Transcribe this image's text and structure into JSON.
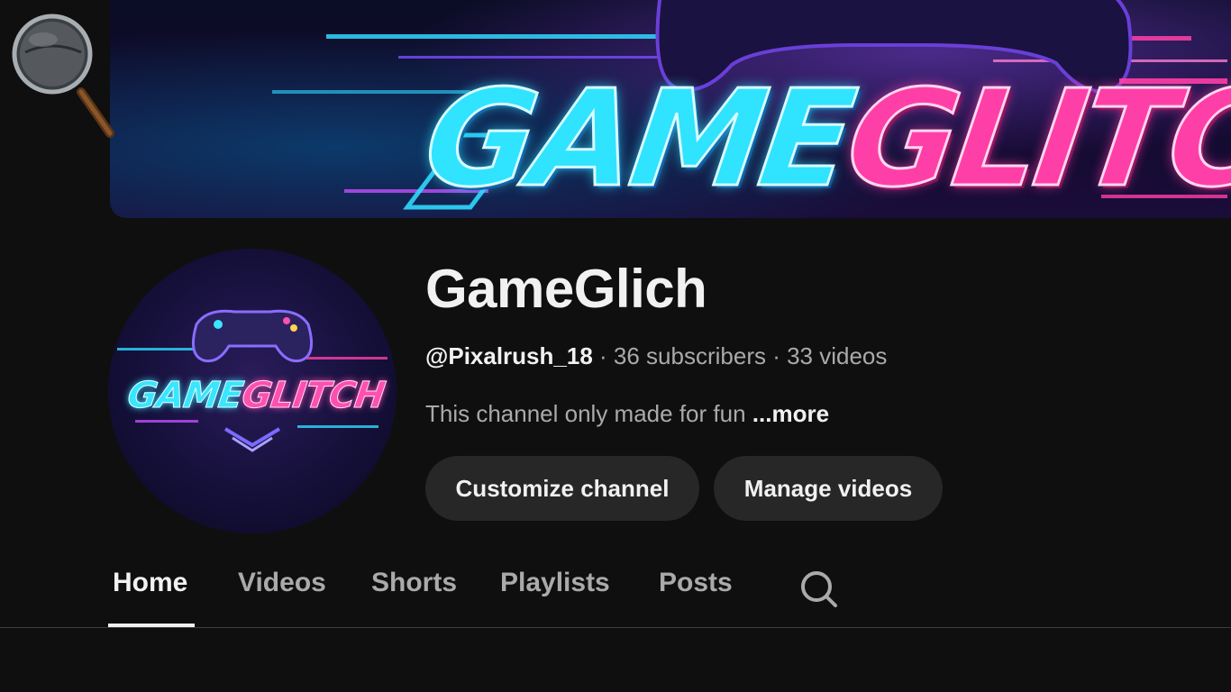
{
  "banner": {
    "text_part_a": "GAME",
    "text_part_b": "GLITC"
  },
  "avatar": {
    "text_part_a": "GAME",
    "text_part_b": "GLITCH"
  },
  "channel": {
    "name": "GameGlich",
    "handle": "@Pixalrush_18",
    "separator": " · ",
    "subscribers": "36 subscribers",
    "videos": "33 videos",
    "description": "This channel only made for fun",
    "more_label": "...more"
  },
  "buttons": {
    "customize": "Customize channel",
    "manage": "Manage videos"
  },
  "tabs": [
    {
      "label": "Home",
      "active": true
    },
    {
      "label": "Videos",
      "active": false
    },
    {
      "label": "Shorts",
      "active": false
    },
    {
      "label": "Playlists",
      "active": false
    },
    {
      "label": "Posts",
      "active": false
    }
  ],
  "icons": {
    "overlay": "magnifier-icon",
    "tab_search": "search-icon"
  },
  "colors": {
    "background": "#0f0f0f",
    "button_bg": "#272727",
    "primary_text": "#f1f1f1",
    "secondary_text": "#aaaaaa",
    "banner_cyan": "#30e3ff",
    "banner_pink": "#ff3fa8"
  }
}
